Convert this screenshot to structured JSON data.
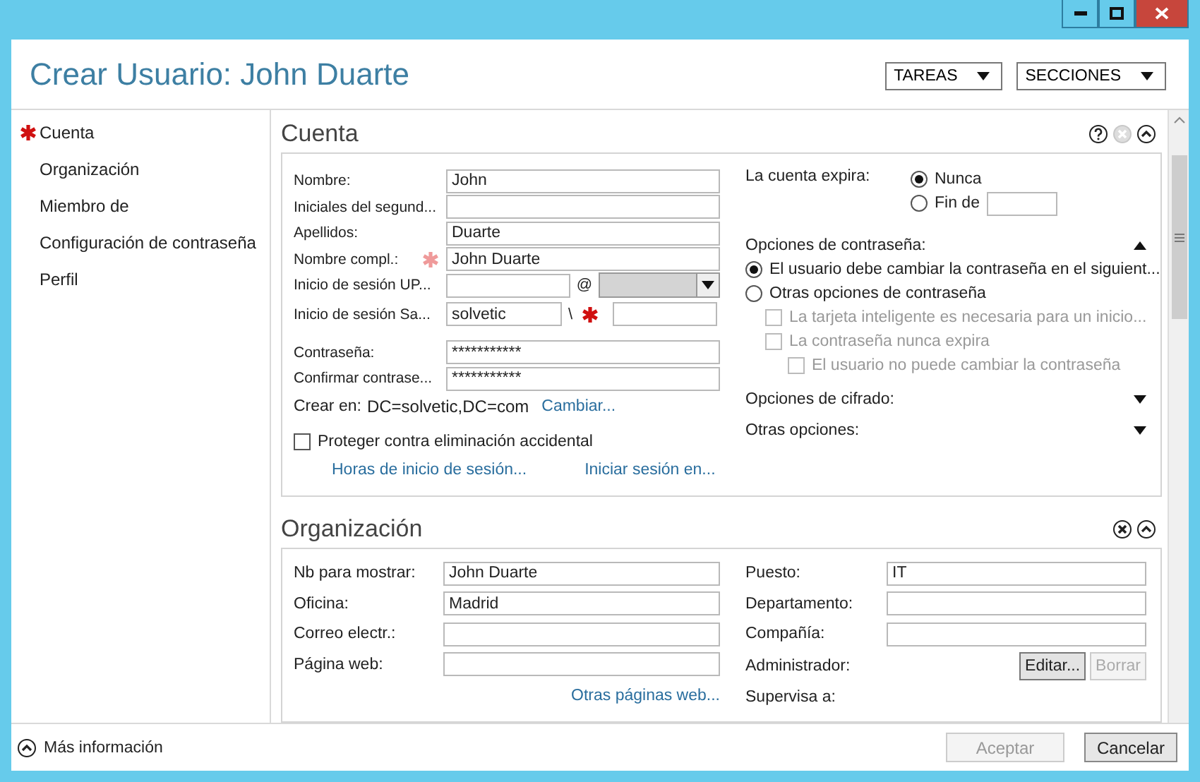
{
  "window": {
    "title": "Crear Usuario: John Duarte",
    "controls": [
      {
        "kind": "minimize"
      },
      {
        "kind": "maximize"
      },
      {
        "kind": "close"
      }
    ]
  },
  "header_menus": [
    {
      "label": "TAREAS"
    },
    {
      "label": "SECCIONES"
    }
  ],
  "sidebar": {
    "items": [
      {
        "label": "Cuenta",
        "required": true
      },
      {
        "label": "Organización",
        "required": false
      },
      {
        "label": "Miembro de",
        "required": false
      },
      {
        "label": "Configuración de contraseña",
        "required": false
      },
      {
        "label": "Perfil",
        "required": false
      }
    ]
  },
  "account": {
    "title": "Cuenta",
    "actions": [
      {
        "kind": "help",
        "disabled": false
      },
      {
        "kind": "close",
        "disabled": true
      },
      {
        "kind": "collapse",
        "disabled": false
      }
    ],
    "fields": [
      {
        "kind": "text",
        "label": "Nombre:",
        "value": "John",
        "required": false
      },
      {
        "kind": "text",
        "label": "Iniciales del segund...",
        "required": false
      },
      {
        "kind": "text",
        "label": "Apellidos:",
        "value": "Duarte",
        "required": false
      },
      {
        "kind": "text",
        "label": "Nombre compl.:",
        "value": "John Duarte",
        "required": true
      },
      {
        "kind": "upn",
        "label": "Inicio de sesión UP...",
        "separator": "@",
        "domain_disabled": true
      },
      {
        "kind": "sam",
        "label": "Inicio de sesión Sa...",
        "value": "solvetic",
        "separator": "\\",
        "required": true
      }
    ],
    "password_fields": [
      {
        "label": "Contraseña:",
        "value": "***********"
      },
      {
        "label": "Confirmar contrase...",
        "value": "***********"
      }
    ],
    "create_in": {
      "label": "Crear en:",
      "value": "DC=solvetic,DC=com",
      "link": "Cambiar..."
    },
    "protect": {
      "label": "Proteger contra eliminación accidental",
      "checked": false
    },
    "links": [
      "Horas de inicio de sesión...",
      "Iniciar sesión en..."
    ],
    "expires": {
      "label": "La cuenta expira:",
      "options": [
        {
          "label": "Nunca",
          "selected": true,
          "kind": "plain"
        },
        {
          "label": "Fin de",
          "selected": false,
          "kind": "date"
        }
      ]
    },
    "password_options": {
      "label": "Opciones de contraseña:",
      "expanded": true,
      "radios": [
        {
          "label": "El usuario debe cambiar la contraseña en el siguient...",
          "selected": true
        },
        {
          "label": "Otras opciones de contraseña",
          "selected": false
        }
      ],
      "checkboxes": [
        {
          "label": "La tarjeta inteligente es necesaria para un inicio...",
          "checked": false,
          "disabled": true
        },
        {
          "label": "La contraseña nunca expira",
          "checked": false,
          "disabled": true,
          "children": [
            {
              "label": "El usuario no puede cambiar la contraseña",
              "checked": false,
              "disabled": true
            }
          ]
        }
      ]
    },
    "collapsibles": [
      {
        "label": "Opciones de cifrado:",
        "expanded": false
      },
      {
        "label": "Otras opciones:",
        "expanded": false
      }
    ]
  },
  "organization": {
    "title": "Organización",
    "actions": [
      {
        "kind": "close",
        "disabled": false
      },
      {
        "kind": "collapse",
        "disabled": false
      }
    ],
    "left_fields": [
      {
        "label": "Nb para mostrar:",
        "value": "John Duarte"
      },
      {
        "label": "Oficina:",
        "value": "Madrid"
      },
      {
        "label": "Correo electr.:"
      },
      {
        "label": "Página web:"
      }
    ],
    "link": "Otras páginas web...",
    "right_fields": [
      {
        "kind": "text",
        "label": "Puesto:",
        "value": "IT"
      },
      {
        "kind": "text",
        "label": "Departamento:"
      },
      {
        "kind": "text",
        "label": "Compañía:"
      },
      {
        "kind": "buttons",
        "label": "Administrador:",
        "buttons": [
          {
            "label": "Editar...",
            "disabled": false
          },
          {
            "label": "Borrar",
            "disabled": true
          }
        ]
      },
      {
        "kind": "label",
        "label": "Supervisa a:"
      }
    ]
  },
  "footer": {
    "more": "Más información",
    "buttons": [
      {
        "label": "Aceptar",
        "disabled": true
      },
      {
        "label": "Cancelar",
        "disabled": false
      }
    ]
  }
}
